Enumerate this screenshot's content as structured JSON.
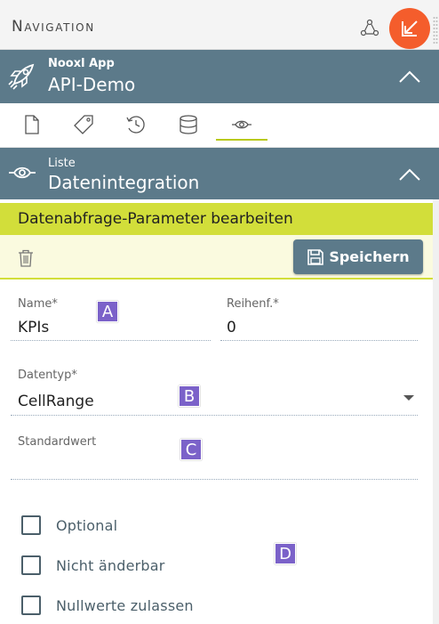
{
  "topbar": {
    "title": "Navigation"
  },
  "app": {
    "subtitle": "Nooxl App",
    "title": "API-Demo"
  },
  "iconbar": {
    "items": [
      {
        "icon": "file-icon"
      },
      {
        "icon": "tag-icon"
      },
      {
        "icon": "history-icon"
      },
      {
        "icon": "database-icon"
      },
      {
        "icon": "eye-icon",
        "active": true
      }
    ]
  },
  "list": {
    "subtitle": "Liste",
    "title": "Datenintegration"
  },
  "edit": {
    "banner": "Datenabfrage-Parameter bearbeiten",
    "save_label": "Speichern"
  },
  "form": {
    "name_label": "Name*",
    "name_value": "KPIs",
    "order_label": "Reihenf.*",
    "order_value": "0",
    "type_label": "Datentyp*",
    "type_value": "CellRange",
    "default_label": "Standardwert",
    "default_value": ""
  },
  "checkboxes": {
    "optional": "Optional",
    "readonly": "Nicht änderbar",
    "nulls": "Nullwerte zulassen"
  },
  "markers": {
    "a": "A",
    "b": "B",
    "c": "C",
    "d": "D"
  },
  "colors": {
    "header": "#5c7a8a",
    "accent": "#d2de3a",
    "orange": "#f45d2c",
    "marker": "#7b62c9"
  }
}
